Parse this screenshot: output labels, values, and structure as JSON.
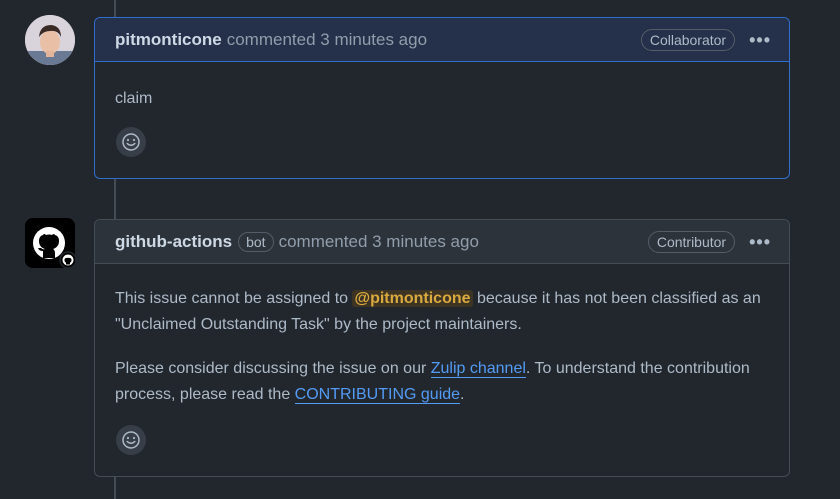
{
  "comments": [
    {
      "author": "pitmonticone",
      "meta": "commented 3 minutes ago",
      "role_badge": "Collaborator",
      "body": "claim",
      "more_label": "•••"
    },
    {
      "author": "github-actions",
      "bot_label": "bot",
      "meta": "commented 3 minutes ago",
      "role_badge": "Contributor",
      "more_label": "•••",
      "p1_before": "This issue cannot be assigned to ",
      "p1_mention": "@pitmonticone",
      "p1_after": " because it has not been classified as an \"Unclaimed Outstanding Task\" by the project maintainers.",
      "p2_before": "Please consider discussing the issue on our ",
      "p2_link1": "Zulip channel",
      "p2_middle": ". To understand the contribution process, please read the ",
      "p2_link2": "CONTRIBUTING guide",
      "p2_after": "."
    }
  ],
  "colors": {
    "background": "#22272e",
    "accent_blue": "#539bf5",
    "mention": "#daaa3f",
    "highlight_border": "#316dca"
  },
  "icons": [
    "smiley-icon",
    "github-logo-icon",
    "kebab-icon"
  ]
}
